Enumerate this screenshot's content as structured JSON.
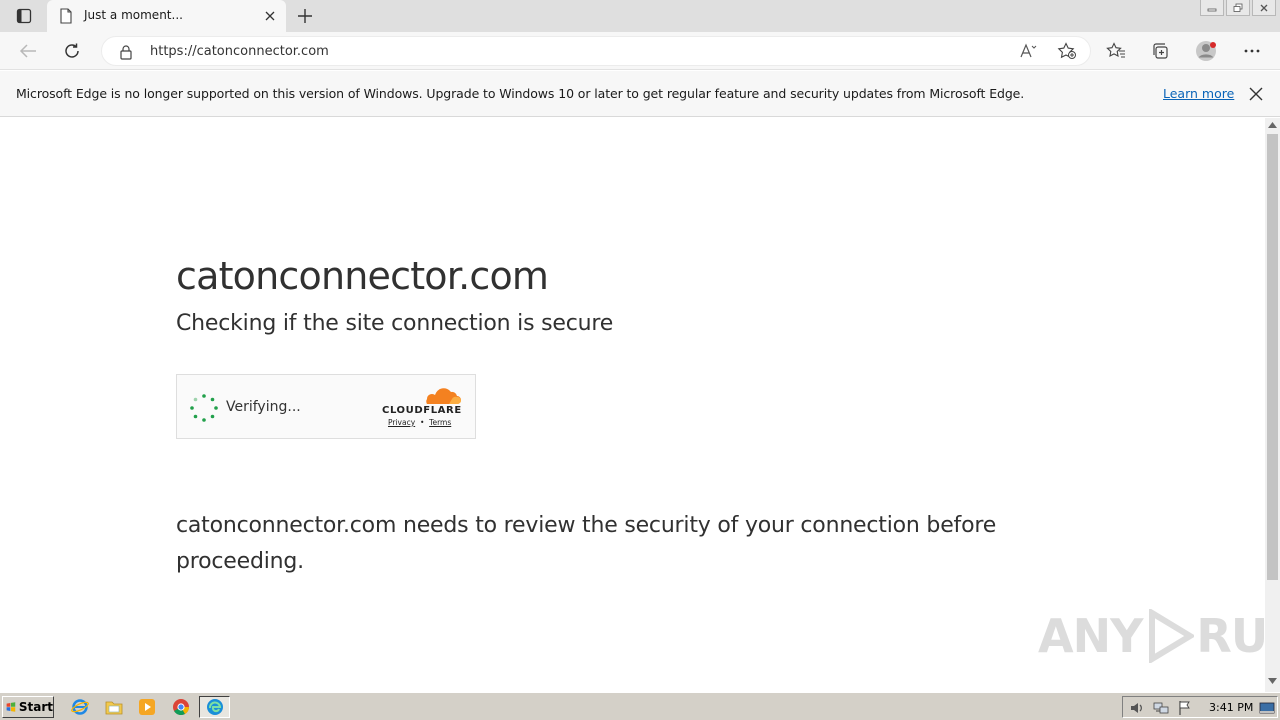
{
  "browser": {
    "tab": {
      "title": "Just a moment..."
    },
    "address": {
      "url": "https://catonconnector.com"
    },
    "infobar": {
      "message": "Microsoft Edge is no longer supported on this version of Windows. Upgrade to Windows 10 or later to get regular feature and security updates from Microsoft Edge.",
      "link": "Learn more"
    }
  },
  "page": {
    "heading": "catonconnector.com",
    "subheading": "Checking if the site connection is secure",
    "widget": {
      "status": "Verifying...",
      "brand": "CLOUDFLARE",
      "privacy": "Privacy",
      "separator": "•",
      "terms": "Terms"
    },
    "body": "catonconnector.com needs to review the security of your connection before proceeding."
  },
  "watermark": {
    "left": "ANY",
    "right": "RUN"
  },
  "taskbar": {
    "start_label": "Start",
    "clock": "3:41 PM"
  },
  "colors": {
    "link": "#0a64b8",
    "cloudflare_orange": "#f48120",
    "spinner_green": "#22a04b"
  }
}
